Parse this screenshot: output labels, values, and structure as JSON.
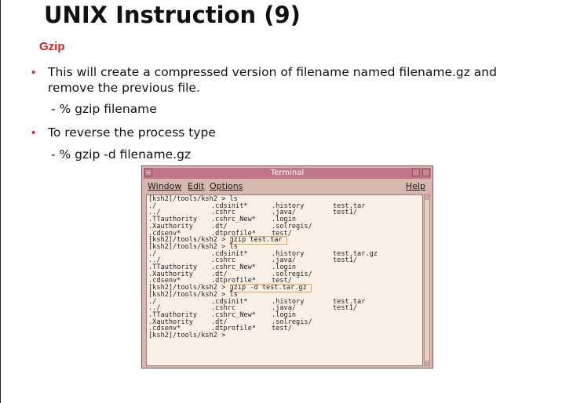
{
  "slide": {
    "title": "UNIX Instruction (9)",
    "subtitle": "Gzip",
    "bullets": [
      {
        "text": "This will create a compressed version of filename named filename.gz and remove the previous file.",
        "sub": "- % gzip filename"
      },
      {
        "text": "To reverse the process type",
        "sub": "- % gzip -d filename.gz"
      }
    ],
    "colors": {
      "accent": "#e02020",
      "terminal_frame": "#d7b8ae",
      "terminal_title": "#c07686",
      "terminal_bg": "#fbf0e8",
      "highlight": "#e6a34a"
    }
  },
  "terminal": {
    "title": "Terminal",
    "menu": [
      "Window",
      "Edit",
      "Options"
    ],
    "help": "Help",
    "lines": [
      [
        "[ksh2]/tools/ksh2 > ls"
      ],
      [
        "./",
        ".cdsinit*",
        ".history",
        "test.tar"
      ],
      [
        "../",
        ".cshrc",
        ".java/",
        "test1/"
      ],
      [
        ".TTauthority",
        ".cshrc_New*",
        ".login"
      ],
      [
        ".Xauthority",
        ".dt/",
        ".solregis/"
      ],
      [
        ".cdsenv*",
        ".dtprofile*",
        "test/"
      ],
      [
        "[ksh2]/tools/ksh2 > gzip test.tar"
      ],
      [
        "[ksh2]/tools/ksh2 > ls"
      ],
      [
        "./",
        ".cdsinit*",
        ".history",
        "test.tar.gz"
      ],
      [
        "../",
        ".cshrc",
        ".java/",
        "test1/"
      ],
      [
        ".TTauthority",
        ".cshrc_New*",
        ".login"
      ],
      [
        ".Xauthority",
        ".dt/",
        ".solregis/"
      ],
      [
        ".cdsenv*",
        ".dtprofile*",
        "test/"
      ],
      [
        "[ksh2]/tools/ksh2 > gzip -d test.tar.gz"
      ],
      [
        "[ksh2]/tools/ksh2 > ls"
      ],
      [
        "./",
        ".cdsinit*",
        ".history",
        "test.tar"
      ],
      [
        "../",
        ".cshrc",
        ".java/",
        "test1/"
      ],
      [
        ".TTauthority",
        ".cshrc_New*",
        ".login"
      ],
      [
        ".Xauthority",
        ".dt/",
        ".solregis/"
      ],
      [
        ".cdsenv*",
        ".dtprofile*",
        "test/"
      ],
      [
        "[ksh2]/tools/ksh2 >"
      ]
    ],
    "highlighted_commands": [
      "gzip test.tar",
      "gzip -d test.tar.gz"
    ]
  }
}
